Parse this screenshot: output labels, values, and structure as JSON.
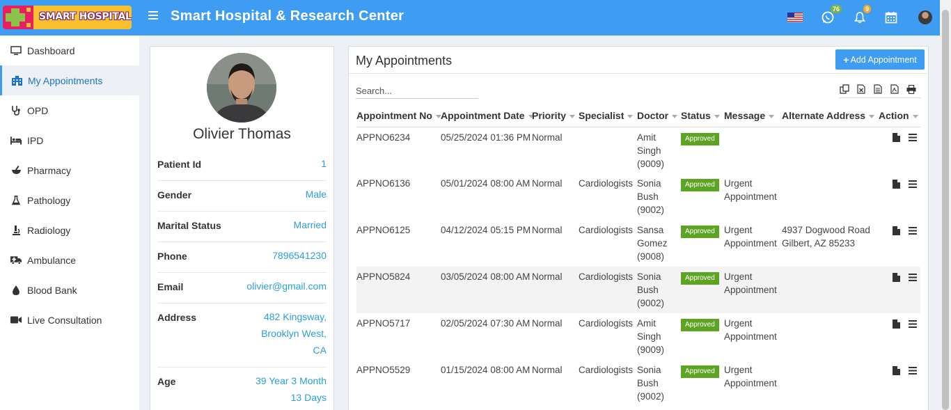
{
  "header": {
    "logo_text": "SMART HOSPITAL",
    "title": "Smart Hospital & Research Center",
    "whatsapp_badge": "76",
    "notification_badge": "9",
    "accent_color": "#3f9cf3"
  },
  "sidebar": {
    "items": [
      {
        "label": "Dashboard",
        "icon": "monitor-icon"
      },
      {
        "label": "My Appointments",
        "icon": "hospital-icon"
      },
      {
        "label": "OPD",
        "icon": "stethoscope-icon"
      },
      {
        "label": "IPD",
        "icon": "bed-icon"
      },
      {
        "label": "Pharmacy",
        "icon": "mortar-pestle-icon"
      },
      {
        "label": "Pathology",
        "icon": "flask-icon"
      },
      {
        "label": "Radiology",
        "icon": "microscope-icon"
      },
      {
        "label": "Ambulance",
        "icon": "ambulance-icon"
      },
      {
        "label": "Blood Bank",
        "icon": "droplet-icon"
      },
      {
        "label": "Live Consultation",
        "icon": "video-icon"
      }
    ]
  },
  "profile": {
    "name": "Olivier Thomas",
    "fields": [
      {
        "label": "Patient Id",
        "value": "1"
      },
      {
        "label": "Gender",
        "value": "Male"
      },
      {
        "label": "Marital Status",
        "value": "Married"
      },
      {
        "label": "Phone",
        "value": "7896541230"
      },
      {
        "label": "Email",
        "value": "olivier@gmail.com"
      },
      {
        "label": "Address",
        "value_lines": [
          "482 Kingsway,",
          "Brooklyn West,",
          "CA"
        ]
      },
      {
        "label": "Age",
        "value_lines": [
          "39 Year 3 Month",
          "13 Days"
        ]
      }
    ]
  },
  "appointments": {
    "title": "My Appointments",
    "add_button": "Add Appointment",
    "search_placeholder": "Search...",
    "columns": [
      "Appointment No",
      "Appointment Date",
      "Priority",
      "Specialist",
      "Doctor",
      "Status",
      "Message",
      "Alternate Address",
      "Action"
    ],
    "rows": [
      {
        "no": "APPNO6234",
        "date": "05/25/2024 01:36 PM",
        "priority": "Normal",
        "specialist": "",
        "doctor": "Amit Singh (9009)",
        "status": "Approved",
        "message": "",
        "address": ""
      },
      {
        "no": "APPNO6136",
        "date": "05/01/2024 08:00 AM",
        "priority": "Normal",
        "specialist": "Cardiologists",
        "doctor": "Sonia Bush (9002)",
        "status": "Approved",
        "message": "Urgent Appointment",
        "address": ""
      },
      {
        "no": "APPNO6125",
        "date": "04/12/2024 05:15 PM",
        "priority": "Normal",
        "specialist": "Cardiologists",
        "doctor": "Sansa Gomez (9008)",
        "status": "Approved",
        "message": "Urgent Appointment",
        "address": "4937 Dogwood Road Gilbert, AZ 85233"
      },
      {
        "no": "APPNO5824",
        "date": "03/05/2024 08:00 AM",
        "priority": "Normal",
        "specialist": "Cardiologists",
        "doctor": "Sonia Bush (9002)",
        "status": "Approved",
        "message": "Urgent Appointment",
        "address": ""
      },
      {
        "no": "APPNO5717",
        "date": "02/05/2024 07:30 AM",
        "priority": "Normal",
        "specialist": "Cardiologists",
        "doctor": "Amit Singh (9009)",
        "status": "Approved",
        "message": "Urgent Appointment",
        "address": ""
      },
      {
        "no": "APPNO5529",
        "date": "01/15/2024 08:00 AM",
        "priority": "Normal",
        "specialist": "Cardiologists",
        "doctor": "Sonia Bush (9002)",
        "status": "Approved",
        "message": "Urgent Appointment",
        "address": ""
      }
    ]
  }
}
